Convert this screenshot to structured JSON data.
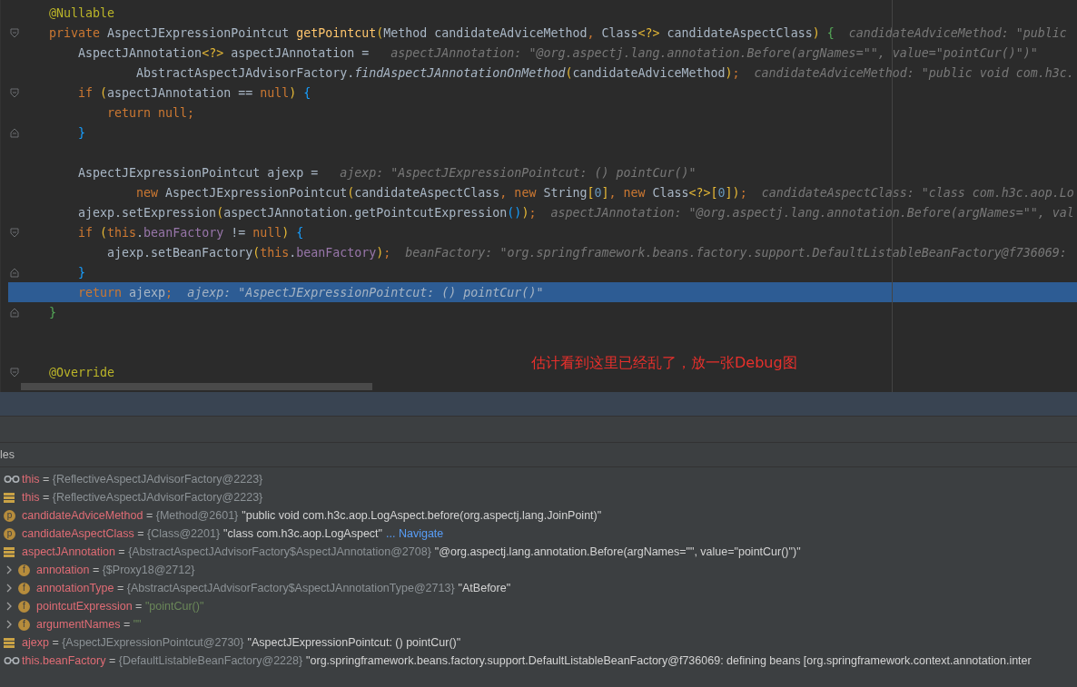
{
  "editor": {
    "lines": [
      {
        "kind": "code",
        "current": false,
        "tokens": [
          {
            "kind": "ann",
            "text": "@Nullable"
          }
        ]
      },
      {
        "kind": "fold_start",
        "current": false,
        "tokens": [
          {
            "kind": "kw",
            "text": "private"
          },
          {
            "kind": "plain",
            "text": " AspectJExpressionPointcut "
          },
          {
            "kind": "fn",
            "text": "getPointcut"
          },
          {
            "kind": "b1",
            "text": "("
          },
          {
            "kind": "plain",
            "text": "Method candidateAdviceMethod"
          },
          {
            "kind": "kw",
            "text": ","
          },
          {
            "kind": "plain",
            "text": " Class"
          },
          {
            "kind": "b1",
            "text": "<?>"
          },
          {
            "kind": "plain",
            "text": " candidateAspectClass"
          },
          {
            "kind": "b1",
            "text": ")"
          },
          {
            "kind": "b3",
            "text": " {"
          }
        ],
        "hint": "candidateAdviceMethod: \"public"
      },
      {
        "kind": "code",
        "current": false,
        "tokens": [
          {
            "kind": "plain",
            "text": "    AspectJAnnotation"
          },
          {
            "kind": "b1",
            "text": "<?>"
          },
          {
            "kind": "plain",
            "text": " aspectJAnnotation = "
          }
        ],
        "hint": "aspectJAnnotation: \"@org.aspectj.lang.annotation.Before(argNames=\"\", value=\"pointCur()\")\""
      },
      {
        "kind": "code",
        "current": false,
        "tokens": [
          {
            "kind": "plain",
            "text": "            AbstractAspectJAdvisorFactory."
          },
          {
            "kind": "static",
            "text": "findAspectJAnnotationOnMethod"
          },
          {
            "kind": "b1",
            "text": "("
          },
          {
            "kind": "plain",
            "text": "candidateAdviceMethod"
          },
          {
            "kind": "b1",
            "text": ")"
          },
          {
            "kind": "kw",
            "text": ";"
          }
        ],
        "hint": "candidateAdviceMethod: \"public void com.h3c."
      },
      {
        "kind": "fold_start",
        "current": false,
        "tokens": [
          {
            "kind": "kw",
            "text": "    if"
          },
          {
            "kind": "b1",
            "text": " ("
          },
          {
            "kind": "plain",
            "text": "aspectJAnnotation == "
          },
          {
            "kind": "kw",
            "text": "null"
          },
          {
            "kind": "b1",
            "text": ")"
          },
          {
            "kind": "b2",
            "text": " {"
          }
        ]
      },
      {
        "kind": "code",
        "current": false,
        "tokens": [
          {
            "kind": "kw",
            "text": "        return null;"
          }
        ]
      },
      {
        "kind": "fold_end",
        "current": false,
        "tokens": [
          {
            "kind": "b2",
            "text": "    }"
          }
        ]
      },
      {
        "kind": "code",
        "current": false
      },
      {
        "kind": "code",
        "current": false,
        "tokens": [
          {
            "kind": "plain",
            "text": "    AspectJExpressionPointcut ajexp = "
          }
        ],
        "hint": "ajexp: \"AspectJExpressionPointcut: () pointCur()\""
      },
      {
        "kind": "code",
        "current": false,
        "tokens": [
          {
            "kind": "kw",
            "text": "            new"
          },
          {
            "kind": "plain",
            "text": " AspectJExpressionPointcut"
          },
          {
            "kind": "b1",
            "text": "("
          },
          {
            "kind": "plain",
            "text": "candidateAspectClass"
          },
          {
            "kind": "kw",
            "text": ", new"
          },
          {
            "kind": "plain",
            "text": " String"
          },
          {
            "kind": "b1",
            "text": "["
          },
          {
            "kind": "num",
            "text": "0"
          },
          {
            "kind": "b1",
            "text": "]"
          },
          {
            "kind": "kw",
            "text": ", new"
          },
          {
            "kind": "plain",
            "text": " Class"
          },
          {
            "kind": "b1",
            "text": "<?>["
          },
          {
            "kind": "num",
            "text": "0"
          },
          {
            "kind": "b1",
            "text": "])"
          },
          {
            "kind": "kw",
            "text": ";"
          }
        ],
        "hint": "candidateAspectClass: \"class com.h3c.aop.Lo"
      },
      {
        "kind": "code",
        "current": false,
        "tokens": [
          {
            "kind": "plain",
            "text": "    ajexp.setExpression"
          },
          {
            "kind": "b1",
            "text": "("
          },
          {
            "kind": "plain",
            "text": "aspectJAnnotation.getPointcutExpression"
          },
          {
            "kind": "b2",
            "text": "()"
          },
          {
            "kind": "b1",
            "text": ")"
          },
          {
            "kind": "kw",
            "text": ";"
          }
        ],
        "hint": "aspectJAnnotation: \"@org.aspectj.lang.annotation.Before(argNames=\"\", val"
      },
      {
        "kind": "fold_start",
        "current": false,
        "tokens": [
          {
            "kind": "kw",
            "text": "    if"
          },
          {
            "kind": "b1",
            "text": " ("
          },
          {
            "kind": "kw",
            "text": "this"
          },
          {
            "kind": "plain",
            "text": "."
          },
          {
            "kind": "field",
            "text": "beanFactory"
          },
          {
            "kind": "plain",
            "text": " != "
          },
          {
            "kind": "kw",
            "text": "null"
          },
          {
            "kind": "b1",
            "text": ")"
          },
          {
            "kind": "b2",
            "text": " {"
          }
        ]
      },
      {
        "kind": "code",
        "current": false,
        "tokens": [
          {
            "kind": "plain",
            "text": "        ajexp.setBeanFactory"
          },
          {
            "kind": "b1",
            "text": "("
          },
          {
            "kind": "kw",
            "text": "this"
          },
          {
            "kind": "plain",
            "text": "."
          },
          {
            "kind": "field",
            "text": "beanFactory"
          },
          {
            "kind": "b1",
            "text": ")"
          },
          {
            "kind": "kw",
            "text": ";"
          }
        ],
        "hint": "beanFactory: \"org.springframework.beans.factory.support.DefaultListableBeanFactory@f736069:"
      },
      {
        "kind": "fold_end",
        "current": false,
        "tokens": [
          {
            "kind": "b2",
            "text": "    }"
          }
        ]
      },
      {
        "kind": "code",
        "current": true,
        "tokens": [
          {
            "kind": "kw",
            "text": "    return"
          },
          {
            "kind": "plain",
            "text": " ajexp"
          },
          {
            "kind": "kw",
            "text": ";"
          }
        ],
        "hint": "ajexp: \"AspectJExpressionPointcut: () pointCur()\""
      },
      {
        "kind": "fold_end",
        "current": false,
        "tokens": [
          {
            "kind": "b3",
            "text": "}"
          }
        ]
      },
      {
        "kind": "code",
        "current": false
      },
      {
        "kind": "code",
        "current": false
      },
      {
        "kind": "fold_start",
        "current": false,
        "tokens": [
          {
            "kind": "ann",
            "text": "@Override"
          }
        ]
      }
    ],
    "note": "估计看到这里已经乱了，放一张Debug图"
  },
  "variables": {
    "title": "les",
    "items": [
      {
        "kind": "watch",
        "name": "this",
        "eq": "=",
        "type": "{ReflectiveAspectJAdvisorFactory@2223}"
      },
      {
        "kind": "local",
        "name": "this",
        "eq": "=",
        "type": "{ReflectiveAspectJAdvisorFactory@2223}"
      },
      {
        "kind": "param",
        "badge": "p",
        "name": "candidateAdviceMethod",
        "eq": "=",
        "type": "{Method@2601}",
        "value": "\"public void com.h3c.aop.LogAspect.before(org.aspectj.lang.JoinPoint)\""
      },
      {
        "kind": "param",
        "badge": "p",
        "name": "candidateAspectClass",
        "eq": "=",
        "type": "{Class@2201}",
        "value": "\"class com.h3c.aop.LogAspect\"",
        "link": "... Navigate"
      },
      {
        "kind": "local",
        "name": "aspectJAnnotation",
        "eq": "=",
        "type": "{AbstractAspectJAdvisorFactory$AspectJAnnotation@2708}",
        "value": "\"@org.aspectj.lang.annotation.Before(argNames=\"\", value=\"pointCur()\")\"",
        "children": [
          {
            "kind": "field",
            "badge": "f",
            "expanded": false,
            "name": "annotation",
            "eq": "=",
            "type": "{$Proxy18@2712}"
          },
          {
            "kind": "field",
            "badge": "f",
            "expanded": false,
            "name": "annotationType",
            "eq": "=",
            "type": "{AbstractAspectJAdvisorFactory$AspectJAnnotationType@2713}",
            "value": "\"AtBefore\""
          },
          {
            "kind": "field",
            "badge": "f",
            "expanded": false,
            "name": "pointcutExpression",
            "eq": "=",
            "string": "\"pointCur()\""
          },
          {
            "kind": "field",
            "badge": "f",
            "expanded": false,
            "name": "argumentNames",
            "eq": "=",
            "string": "\"\""
          }
        ]
      },
      {
        "kind": "local",
        "name": "ajexp",
        "eq": "=",
        "type": "{AspectJExpressionPointcut@2730}",
        "value": "\"AspectJExpressionPointcut: () pointCur()\""
      },
      {
        "kind": "watch",
        "name": "this.beanFactory",
        "eq": "=",
        "type": "{DefaultListableBeanFactory@2228}",
        "value": "\"org.springframework.beans.factory.support.DefaultListableBeanFactory@f736069: defining beans [org.springframework.context.annotation.inter"
      }
    ]
  }
}
